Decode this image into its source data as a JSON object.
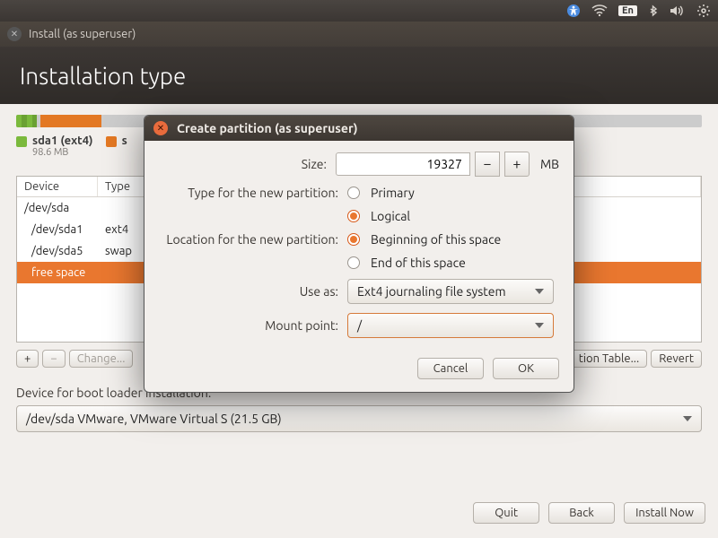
{
  "panel": {
    "lang": "En"
  },
  "window": {
    "title": "Install (as superuser)",
    "heading": "Installation type"
  },
  "legend": {
    "sda1_name": "sda1 (ext4)",
    "sda1_size": "98.6 MB",
    "s_label": "s"
  },
  "table": {
    "headers": {
      "device": "Device",
      "type": "Type"
    },
    "rows": {
      "r0": "/dev/sda",
      "r1_dev": "/dev/sda1",
      "r1_type": "ext4",
      "r1_mount": "/",
      "r2_dev": "/dev/sda5",
      "r2_type": "swap",
      "r3_dev": "free space"
    }
  },
  "toolbar": {
    "plus": "+",
    "minus": "−",
    "change": "Change...",
    "newtable_tail": "tion Table...",
    "revert": "Revert"
  },
  "bootloader": {
    "label": "Device for boot loader installation:",
    "value": "/dev/sda   VMware, VMware Virtual S (21.5 GB)"
  },
  "bottom": {
    "quit": "Quit",
    "back": "Back",
    "install": "Install Now"
  },
  "dialog": {
    "title": "Create partition (as superuser)",
    "size_label": "Size:",
    "size_value": "19327",
    "size_unit": "MB",
    "type_label": "Type for the new partition:",
    "type_primary": "Primary",
    "type_logical": "Logical",
    "loc_label": "Location for the new partition:",
    "loc_begin": "Beginning of this space",
    "loc_end": "End of this space",
    "useas_label": "Use as:",
    "useas_value": "Ext4 journaling file system",
    "mount_label": "Mount point:",
    "mount_value": "/",
    "cancel": "Cancel",
    "ok": "OK"
  }
}
